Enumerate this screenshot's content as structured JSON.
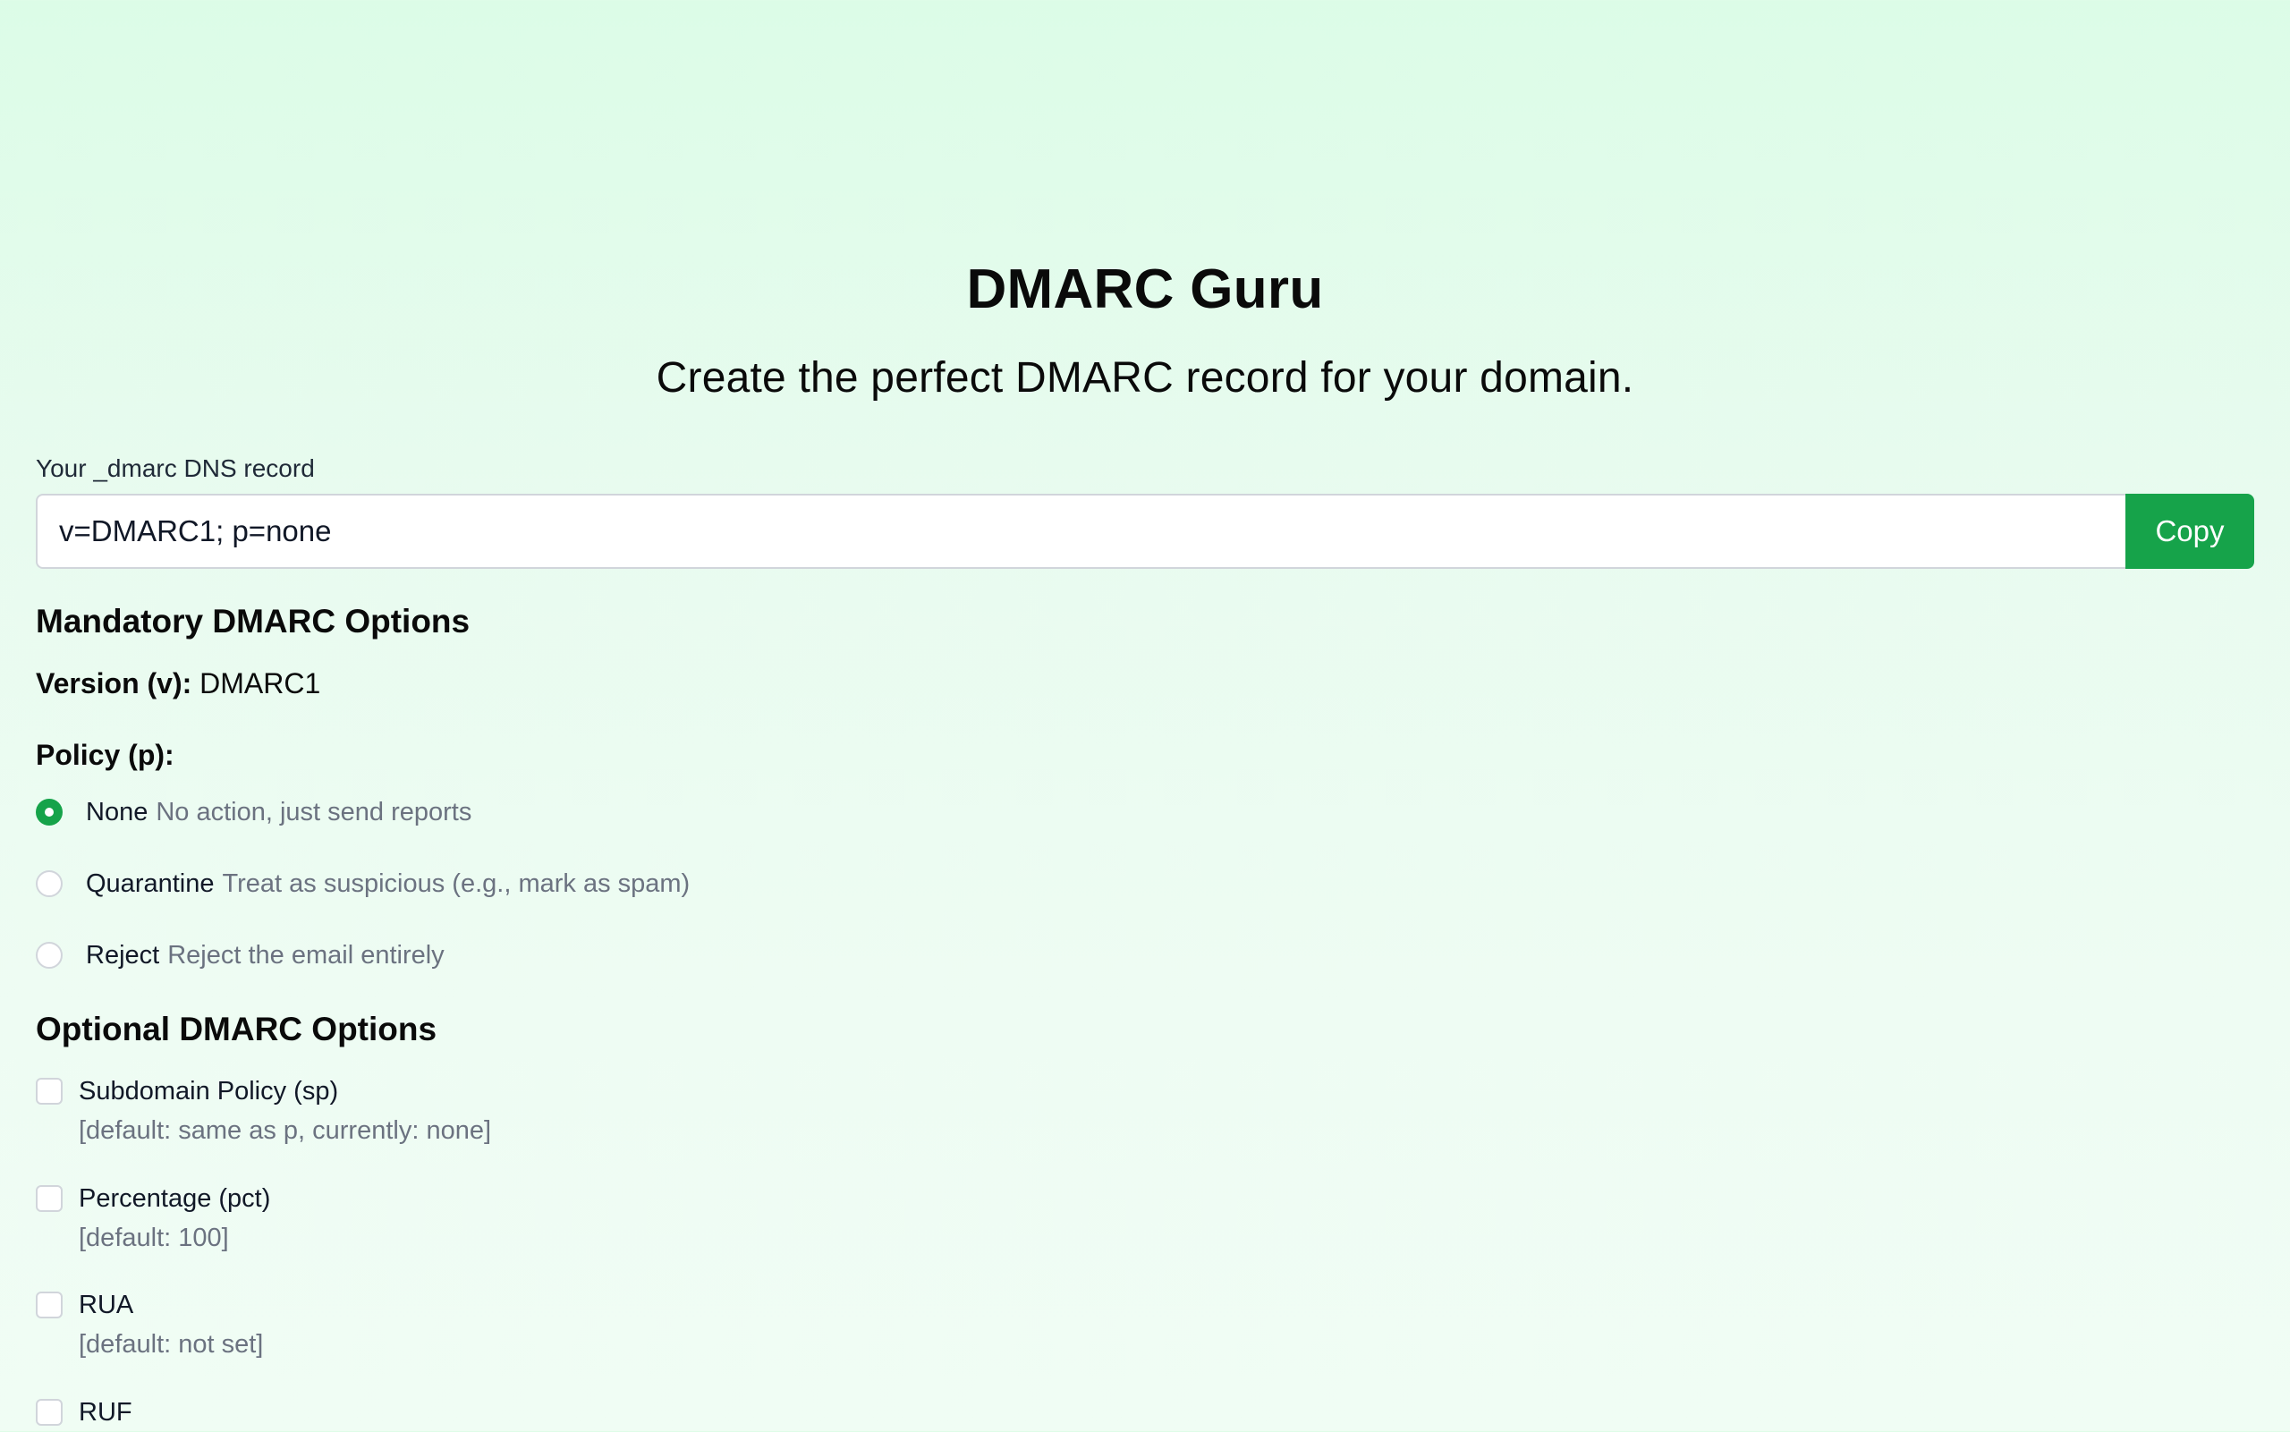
{
  "header": {
    "title": "DMARC Guru",
    "subtitle": "Create the perfect DMARC record for your domain."
  },
  "record": {
    "label": "Your _dmarc DNS record",
    "value": "v=DMARC1; p=none",
    "copy_label": "Copy"
  },
  "mandatory": {
    "heading": "Mandatory DMARC Options",
    "version_label": "Version (v):",
    "version_value": "DMARC1",
    "policy_label": "Policy (p):",
    "policies": [
      {
        "name": "None",
        "description": "No action, just send reports",
        "selected": true
      },
      {
        "name": "Quarantine",
        "description": "Treat as suspicious (e.g., mark as spam)",
        "selected": false
      },
      {
        "name": "Reject",
        "description": "Reject the email entirely",
        "selected": false
      }
    ]
  },
  "optional": {
    "heading": "Optional DMARC Options",
    "items": [
      {
        "label": "Subdomain Policy (sp)",
        "default": "[default: same as p, currently: none]",
        "checked": false
      },
      {
        "label": "Percentage (pct)",
        "default": "[default: 100]",
        "checked": false
      },
      {
        "label": "RUA",
        "default": "[default: not set]",
        "checked": false
      },
      {
        "label": "RUF",
        "default": "",
        "checked": false
      }
    ]
  },
  "colors": {
    "accent": "#16a34a",
    "background_top": "#dcfce7",
    "background_bottom": "#f0fdf4",
    "muted_text": "#6b7280",
    "border": "#d1d5db"
  }
}
